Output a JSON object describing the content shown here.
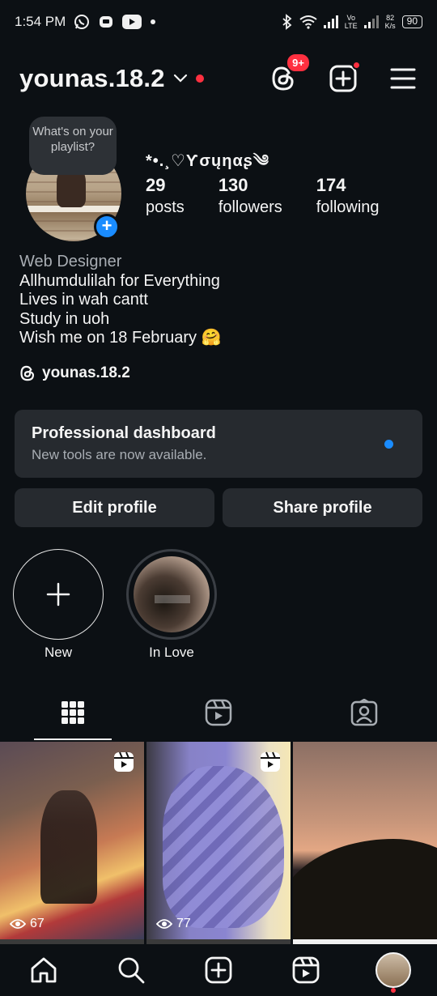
{
  "status_bar": {
    "time": "1:54 PM",
    "network_speed_top": "82",
    "network_speed_bottom": "K/s",
    "volte_top": "Vo",
    "volte_bottom": "LTE",
    "battery": "90"
  },
  "header": {
    "username": "younas.18.2",
    "threads_badge": "9+"
  },
  "profile": {
    "note": "What's on your playlist?",
    "display_name": "*•.¸♡Ƴσųηαʂ༄",
    "stats": [
      {
        "value": "29",
        "label": "posts"
      },
      {
        "value": "130",
        "label": "followers"
      },
      {
        "value": "174",
        "label": "following"
      }
    ],
    "bio": {
      "category": "Web Designer",
      "lines": [
        "Allhumdulilah for Everything",
        "Lives in wah cantt",
        "Study in uoh",
        "Wish me on 18 February 🤗"
      ]
    },
    "threads_handle": "younas.18.2"
  },
  "dashboard": {
    "title": "Professional dashboard",
    "subtitle": "New tools are now available."
  },
  "buttons": {
    "edit": "Edit profile",
    "share": "Share profile"
  },
  "highlights": [
    {
      "label": "New"
    },
    {
      "label": "In Love"
    }
  ],
  "tabs": [
    {
      "icon": "grid-icon",
      "active": true
    },
    {
      "icon": "reels-icon",
      "active": false
    },
    {
      "icon": "tagged-icon",
      "active": false
    }
  ],
  "posts": [
    {
      "views": "67",
      "type": "reel"
    },
    {
      "views": "77",
      "type": "reel"
    },
    {
      "views": "",
      "type": "photo"
    }
  ],
  "bottom_nav": [
    "home-icon",
    "search-icon",
    "create-icon",
    "reels-icon",
    "profile-avatar"
  ],
  "colors": {
    "background": "#0c1014",
    "card": "#262a2f",
    "accent_blue": "#1a8cff",
    "notification_red": "#ff3040"
  }
}
